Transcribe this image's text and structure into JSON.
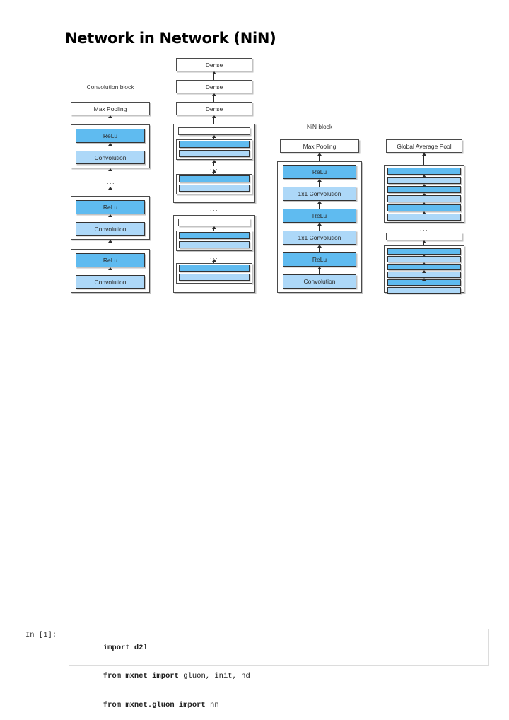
{
  "slide": {
    "title": "Network in Network (NiN)",
    "columns": [
      {
        "id": "convolution-block",
        "label": "Convolution block",
        "top_box": "Max Pooling",
        "blocks": [
          {
            "layers": [
              "ReLu",
              "Convolution"
            ]
          },
          {
            "layers": [
              "ReLu",
              "Convolution"
            ]
          }
        ],
        "ellipsis": "..."
      },
      {
        "id": "vgg-column",
        "label": "",
        "dense_boxes": [
          "Dense",
          "Dense",
          "Dense"
        ],
        "ellipsis": "...",
        "inner_ellipsis": "..."
      },
      {
        "id": "nin-block",
        "label": "NiN block",
        "top_box": "Max Pooling",
        "layers": [
          "ReLu",
          "1x1 Convolution",
          "ReLu",
          "1x1 Convolution",
          "ReLu",
          "Convolution"
        ]
      },
      {
        "id": "nin-network",
        "label": "",
        "top_box": "Global Average Pool",
        "ellipsis": "..."
      }
    ]
  },
  "notebook": {
    "prompt": "In [1]:",
    "code": [
      [
        {
          "t": "import d2l",
          "b": true
        }
      ],
      [
        {
          "t": "from mxnet import ",
          "b": true
        },
        {
          "t": "gluon, init, nd",
          "b": false
        }
      ],
      [
        {
          "t": "from mxnet.gluon import ",
          "b": true
        },
        {
          "t": "nn",
          "b": false
        }
      ]
    ]
  },
  "colors": {
    "relu": "#5FBBF0",
    "convolution": "#ADD8F8",
    "box_border": "#4a4a4a",
    "text": "#2a2a2a",
    "background": "#ffffff"
  }
}
